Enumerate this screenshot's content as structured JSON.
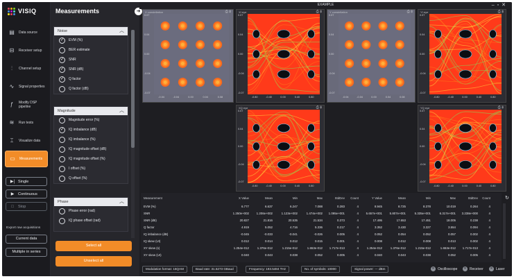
{
  "app": {
    "name": "VISIQ",
    "window_title": "EXAMPLE"
  },
  "colors": {
    "accent": "#f28c28",
    "panel": "#26262b",
    "background": "#1e1e22"
  },
  "sidebar": {
    "items": [
      {
        "label": "Data source",
        "icon": "database-icon"
      },
      {
        "label": "Receiver setup",
        "icon": "receiver-icon"
      },
      {
        "label": "Channel setup",
        "icon": "channel-icon"
      },
      {
        "label": "Signal properties",
        "icon": "signal-icon"
      },
      {
        "label": "Modify DSP pipeline",
        "icon": "function-icon"
      },
      {
        "label": "Run tests",
        "icon": "tests-icon"
      },
      {
        "label": "Visualize data",
        "icon": "visualize-icon"
      },
      {
        "label": "Measurements",
        "icon": "measurements-icon"
      }
    ],
    "single_label": "Single",
    "continuous_label": "Continuous",
    "stop_label": "Stop",
    "export_label": "Export raw acquisitions",
    "current_data_label": "Current data",
    "multiple_in_series_label": "Multiple in series"
  },
  "panel": {
    "title": "Measurements",
    "groups": [
      {
        "title": "Noise",
        "options": [
          {
            "label": "EVM (%)",
            "checked": true
          },
          {
            "label": "BER estimate",
            "checked": false
          },
          {
            "label": "SNR",
            "checked": true
          },
          {
            "label": "SNR (dB)",
            "checked": true
          },
          {
            "label": "Q factor",
            "checked": true
          },
          {
            "label": "Q factor (dB)",
            "checked": false
          }
        ]
      },
      {
        "title": "Magnitude",
        "options": [
          {
            "label": "Magnitude error (%)",
            "checked": false
          },
          {
            "label": "IQ imbalance (dB)",
            "checked": true
          },
          {
            "label": "IQ imbalance (%)",
            "checked": false
          },
          {
            "label": "IQ magnitude offset (dB)",
            "checked": false
          },
          {
            "label": "IQ magnitude offset (%)",
            "checked": false
          },
          {
            "label": "I offset (%)",
            "checked": false
          },
          {
            "label": "Q offset (%)",
            "checked": false
          }
        ]
      },
      {
        "title": "Phase",
        "options": [
          {
            "label": "Phase error (rad)",
            "checked": false
          },
          {
            "label": "IQ phase offset (rad)",
            "checked": false
          }
        ]
      }
    ],
    "select_all_label": "Select all",
    "unselect_all_label": "Unselect all"
  },
  "plots": {
    "constellation_x": {
      "title": "X constellation",
      "yticks": [
        "0.07",
        "0.04",
        "0.00",
        "-0.04",
        "-0.07"
      ],
      "xticks": [
        "-0.04",
        "-0.04",
        "0.00",
        "0.04",
        "0.08"
      ]
    },
    "eye_xi": {
      "title": "XI eye",
      "yticks": [
        "0.07",
        "0.04",
        "0.00",
        "-0.04",
        "-0.07"
      ],
      "xticks": [
        "-0.80",
        "-0.40",
        "0.00",
        "0.40",
        "0.80"
      ]
    },
    "constellation_y": {
      "title": "Y constellation",
      "yticks": [
        "0.07",
        "0.04",
        "0.00",
        "-0.04",
        "-0.07"
      ],
      "xticks": [
        "-0.04",
        "-0.04",
        "0.00",
        "0.04",
        "0.08"
      ]
    },
    "eye_yi": {
      "title": "YI eye",
      "yticks": [
        "0.07",
        "0.04",
        "0.00",
        "-0.04",
        "-0.07"
      ],
      "xticks": [
        "-0.80",
        "-0.40",
        "0.00",
        "0.40",
        "0.80"
      ]
    },
    "eye_xq": {
      "title": "XQ eye",
      "yticks": [
        "0.07",
        "0.04",
        "0.00",
        "-0.04",
        "-0.07"
      ],
      "xticks": [
        "-0.80",
        "-0.40",
        "0.00",
        "0.40",
        "0.80"
      ]
    },
    "eye_yq": {
      "title": "YQ eye",
      "yticks": [
        "0.07",
        "0.04",
        "0.00",
        "-0.04",
        "-0.07"
      ],
      "xticks": [
        "-0.80",
        "-0.40",
        "0.00",
        "0.40",
        "0.80"
      ]
    }
  },
  "table": {
    "headers": [
      "Measurement",
      "X Value",
      "Mean",
      "Min",
      "Max",
      "StdDev",
      "Count",
      "Y Value",
      "Mean",
      "Min",
      "Max",
      "StdDev",
      "Count"
    ],
    "rows": [
      [
        "EVM (%)",
        "6.777",
        "6.637",
        "6.247",
        "7.088",
        "0.283",
        "4",
        "8.945",
        "8.725",
        "8.378",
        "10.019",
        "0.264",
        "4"
      ],
      [
        "SNR",
        "1.250e+002",
        "1.206e+002",
        "1.123e+002",
        "1.474e+002",
        "1.095e+001",
        "4",
        "5.657e+001",
        "5.807e+001",
        "5.335e+001",
        "6.317e+001",
        "3.238e+000",
        "4"
      ],
      [
        "SNR (dB)",
        "20.827",
        "21.816",
        "20.535",
        "21.534",
        "0.373",
        "4",
        "17.495",
        "17.653",
        "17.451",
        "18.005",
        "0.238",
        "4"
      ],
      [
        "Q factor",
        "4.919",
        "5.052",
        "4.716",
        "5.336",
        "0.217",
        "4",
        "3.352",
        "3.430",
        "3.327",
        "3.554",
        "0.094",
        "4"
      ],
      [
        "IQ imbalance (dB)",
        "-0.045",
        "-0.033",
        "-0.041",
        "-0.026",
        "0.005",
        "4",
        "0.052",
        "0.054",
        "0.052",
        "0.057",
        "0.002",
        "4"
      ],
      [
        "IQ skew (UI)",
        "0.012",
        "0.014",
        "0.012",
        "0.015",
        "0.001",
        "4",
        "0.008",
        "0.012",
        "0.008",
        "0.013",
        "0.002",
        "4"
      ],
      [
        "XY skew (s)",
        "1.254e-012",
        "1.376e-012",
        "1.215e-012",
        "1.653e-012",
        "1.717e-013",
        "4",
        "1.254e-012",
        "1.376e-012",
        "1.215e-012",
        "1.653e-012",
        "1.717e-013",
        "4"
      ],
      [
        "XY skew (UI)",
        "0.040",
        "0.043",
        "0.038",
        "0.052",
        "0.005",
        "4",
        "0.040",
        "0.043",
        "0.038",
        "0.052",
        "0.005",
        "4"
      ]
    ]
  },
  "status": {
    "modulation": "Modulation format: 16QAM",
    "baud": "Baud rate: 31.5273 GBaud",
    "frequency": "Frequency: 193.5484 THz",
    "symbols": "No. of symbols: 10000",
    "power": "Signal power: --- dBm",
    "oscilloscope": "Oscilloscope",
    "receiver": "Receiver",
    "laser": "Laser"
  }
}
